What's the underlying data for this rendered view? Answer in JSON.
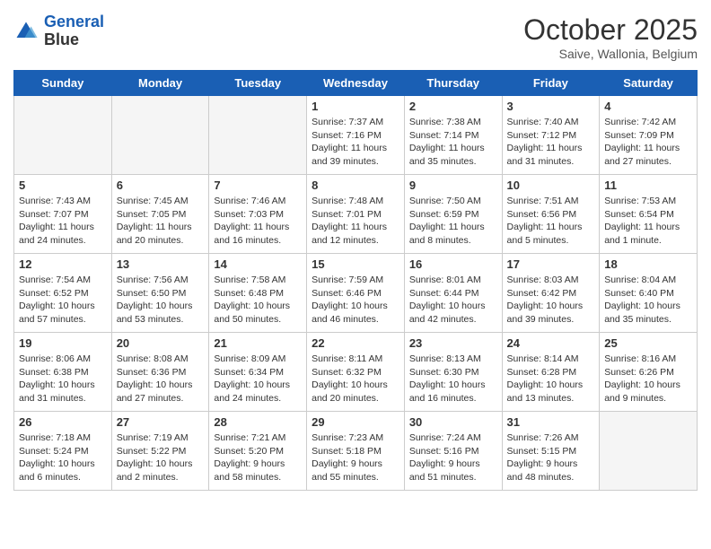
{
  "header": {
    "logo_line1": "General",
    "logo_line2": "Blue",
    "month": "October 2025",
    "location": "Saive, Wallonia, Belgium"
  },
  "weekdays": [
    "Sunday",
    "Monday",
    "Tuesday",
    "Wednesday",
    "Thursday",
    "Friday",
    "Saturday"
  ],
  "weeks": [
    [
      {
        "day": "",
        "info": ""
      },
      {
        "day": "",
        "info": ""
      },
      {
        "day": "",
        "info": ""
      },
      {
        "day": "1",
        "info": "Sunrise: 7:37 AM\nSunset: 7:16 PM\nDaylight: 11 hours\nand 39 minutes."
      },
      {
        "day": "2",
        "info": "Sunrise: 7:38 AM\nSunset: 7:14 PM\nDaylight: 11 hours\nand 35 minutes."
      },
      {
        "day": "3",
        "info": "Sunrise: 7:40 AM\nSunset: 7:12 PM\nDaylight: 11 hours\nand 31 minutes."
      },
      {
        "day": "4",
        "info": "Sunrise: 7:42 AM\nSunset: 7:09 PM\nDaylight: 11 hours\nand 27 minutes."
      }
    ],
    [
      {
        "day": "5",
        "info": "Sunrise: 7:43 AM\nSunset: 7:07 PM\nDaylight: 11 hours\nand 24 minutes."
      },
      {
        "day": "6",
        "info": "Sunrise: 7:45 AM\nSunset: 7:05 PM\nDaylight: 11 hours\nand 20 minutes."
      },
      {
        "day": "7",
        "info": "Sunrise: 7:46 AM\nSunset: 7:03 PM\nDaylight: 11 hours\nand 16 minutes."
      },
      {
        "day": "8",
        "info": "Sunrise: 7:48 AM\nSunset: 7:01 PM\nDaylight: 11 hours\nand 12 minutes."
      },
      {
        "day": "9",
        "info": "Sunrise: 7:50 AM\nSunset: 6:59 PM\nDaylight: 11 hours\nand 8 minutes."
      },
      {
        "day": "10",
        "info": "Sunrise: 7:51 AM\nSunset: 6:56 PM\nDaylight: 11 hours\nand 5 minutes."
      },
      {
        "day": "11",
        "info": "Sunrise: 7:53 AM\nSunset: 6:54 PM\nDaylight: 11 hours\nand 1 minute."
      }
    ],
    [
      {
        "day": "12",
        "info": "Sunrise: 7:54 AM\nSunset: 6:52 PM\nDaylight: 10 hours\nand 57 minutes."
      },
      {
        "day": "13",
        "info": "Sunrise: 7:56 AM\nSunset: 6:50 PM\nDaylight: 10 hours\nand 53 minutes."
      },
      {
        "day": "14",
        "info": "Sunrise: 7:58 AM\nSunset: 6:48 PM\nDaylight: 10 hours\nand 50 minutes."
      },
      {
        "day": "15",
        "info": "Sunrise: 7:59 AM\nSunset: 6:46 PM\nDaylight: 10 hours\nand 46 minutes."
      },
      {
        "day": "16",
        "info": "Sunrise: 8:01 AM\nSunset: 6:44 PM\nDaylight: 10 hours\nand 42 minutes."
      },
      {
        "day": "17",
        "info": "Sunrise: 8:03 AM\nSunset: 6:42 PM\nDaylight: 10 hours\nand 39 minutes."
      },
      {
        "day": "18",
        "info": "Sunrise: 8:04 AM\nSunset: 6:40 PM\nDaylight: 10 hours\nand 35 minutes."
      }
    ],
    [
      {
        "day": "19",
        "info": "Sunrise: 8:06 AM\nSunset: 6:38 PM\nDaylight: 10 hours\nand 31 minutes."
      },
      {
        "day": "20",
        "info": "Sunrise: 8:08 AM\nSunset: 6:36 PM\nDaylight: 10 hours\nand 27 minutes."
      },
      {
        "day": "21",
        "info": "Sunrise: 8:09 AM\nSunset: 6:34 PM\nDaylight: 10 hours\nand 24 minutes."
      },
      {
        "day": "22",
        "info": "Sunrise: 8:11 AM\nSunset: 6:32 PM\nDaylight: 10 hours\nand 20 minutes."
      },
      {
        "day": "23",
        "info": "Sunrise: 8:13 AM\nSunset: 6:30 PM\nDaylight: 10 hours\nand 16 minutes."
      },
      {
        "day": "24",
        "info": "Sunrise: 8:14 AM\nSunset: 6:28 PM\nDaylight: 10 hours\nand 13 minutes."
      },
      {
        "day": "25",
        "info": "Sunrise: 8:16 AM\nSunset: 6:26 PM\nDaylight: 10 hours\nand 9 minutes."
      }
    ],
    [
      {
        "day": "26",
        "info": "Sunrise: 7:18 AM\nSunset: 5:24 PM\nDaylight: 10 hours\nand 6 minutes."
      },
      {
        "day": "27",
        "info": "Sunrise: 7:19 AM\nSunset: 5:22 PM\nDaylight: 10 hours\nand 2 minutes."
      },
      {
        "day": "28",
        "info": "Sunrise: 7:21 AM\nSunset: 5:20 PM\nDaylight: 9 hours\nand 58 minutes."
      },
      {
        "day": "29",
        "info": "Sunrise: 7:23 AM\nSunset: 5:18 PM\nDaylight: 9 hours\nand 55 minutes."
      },
      {
        "day": "30",
        "info": "Sunrise: 7:24 AM\nSunset: 5:16 PM\nDaylight: 9 hours\nand 51 minutes."
      },
      {
        "day": "31",
        "info": "Sunrise: 7:26 AM\nSunset: 5:15 PM\nDaylight: 9 hours\nand 48 minutes."
      },
      {
        "day": "",
        "info": ""
      }
    ]
  ]
}
